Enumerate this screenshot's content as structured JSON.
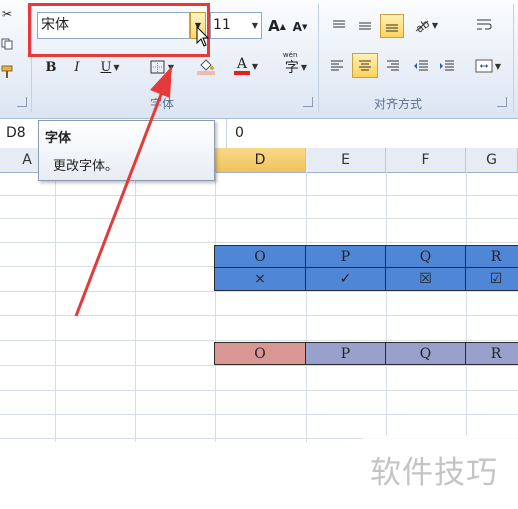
{
  "ribbon": {
    "font_group": {
      "label": "字体",
      "font_name": "宋体",
      "font_size": "11",
      "bold": "B",
      "italic": "I",
      "underline": "U",
      "font_color_letter": "A"
    },
    "alignment_group": {
      "label": "对齐方式"
    }
  },
  "formula_bar": {
    "name_box": "D8",
    "value": "0"
  },
  "tooltip": {
    "title": "字体",
    "description": "更改字体。"
  },
  "columns": [
    {
      "label": "A",
      "selected": false
    },
    {
      "label": "D",
      "selected": true
    },
    {
      "label": "E",
      "selected": false
    },
    {
      "label": "F",
      "selected": false
    },
    {
      "label": "G",
      "selected": false
    }
  ],
  "blue_table": {
    "header_row": [
      "O",
      "P",
      "Q",
      "R"
    ],
    "symbol_row": [
      "×",
      "✓",
      "☒",
      "☑"
    ]
  },
  "pink_row": [
    "O",
    "P",
    "Q",
    "R"
  ],
  "watermark": "软件技巧",
  "colors": {
    "highlight_red": "#e63a3a",
    "blue_fill": "#4f86d6",
    "pink_fill": "#d99692",
    "purple_fill": "#9aa0cc",
    "selected_header": "#f4ca6b"
  }
}
